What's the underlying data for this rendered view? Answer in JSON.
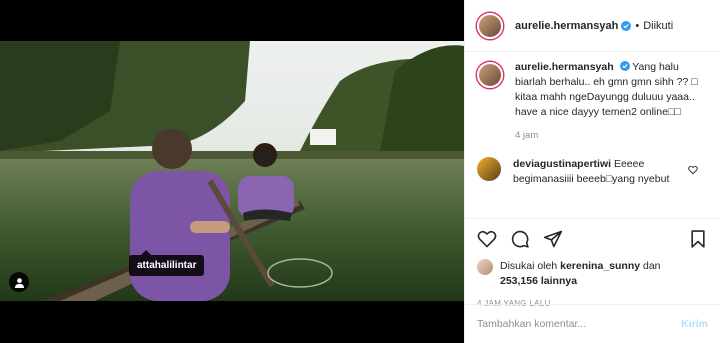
{
  "post": {
    "username": "aurelie.hermansyah",
    "follow_status": "Diikuti",
    "caption_username": "aurelie.hermansyah",
    "caption_text": "Yang halu biarlah berhalu.. eh gmn gmn sihh ?? □ kitaa mahh ngeDayungg duluuu yaaa.. have a nice dayyy temen2 online□□",
    "caption_time": "4 jam",
    "comment": {
      "username": "deviagustinapertiwi",
      "text": "Eeeee begimanasiiii beeeb□yang nyebut dijakpari□"
    },
    "likes": {
      "prefix": "Disukai oleh",
      "user": "kerenina_sunny",
      "middle": "dan",
      "count": "253,156 lainnya"
    },
    "posted_time": "4 JAM YANG LALU"
  },
  "media": {
    "tag_label": "attahalilintar"
  },
  "comment_box": {
    "placeholder": "Tambahkan komentar...",
    "send_label": "Kirim"
  },
  "colors": {
    "accent": "#0095f6",
    "send_disabled": "#b2dffc",
    "verified": "#3897f0"
  }
}
